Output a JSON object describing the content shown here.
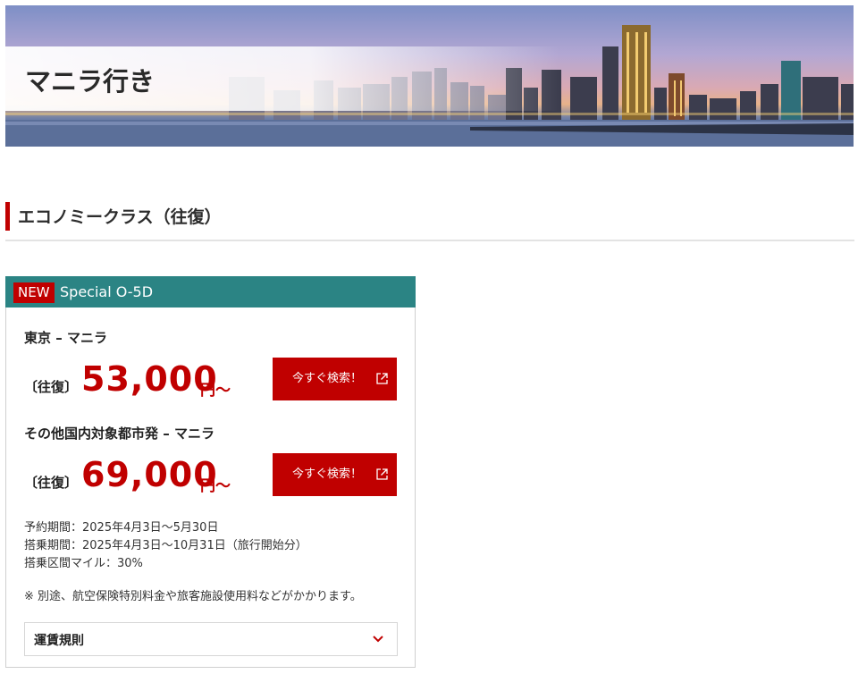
{
  "hero": {
    "title": "マニラ行き"
  },
  "section": {
    "title": "エコノミークラス（往復）"
  },
  "fare_card": {
    "badge": "NEW",
    "title": "Special O-5D",
    "routes": [
      {
        "route": "東京 – マニラ",
        "trip": "〔往復〕",
        "price": "53,000",
        "unit": "円～",
        "button": "今すぐ検索！"
      },
      {
        "route": "その他国内対象都市発 – マニラ",
        "trip": "〔往復〕",
        "price": "69,000",
        "unit": "円～",
        "button": "今すぐ検索！"
      }
    ],
    "info": [
      "予約期間：2025年4月3日～5月30日",
      "搭乗期間：2025年4月3日～10月31日（旅行開始分）",
      "搭乗区間マイル：30%"
    ],
    "note": "※ 別途、航空保険特別料金や旅客施設使用料などがかかります。",
    "accordion_label": "運賃規則"
  },
  "colors": {
    "accent": "#c00000",
    "card_header": "#2b8484"
  }
}
